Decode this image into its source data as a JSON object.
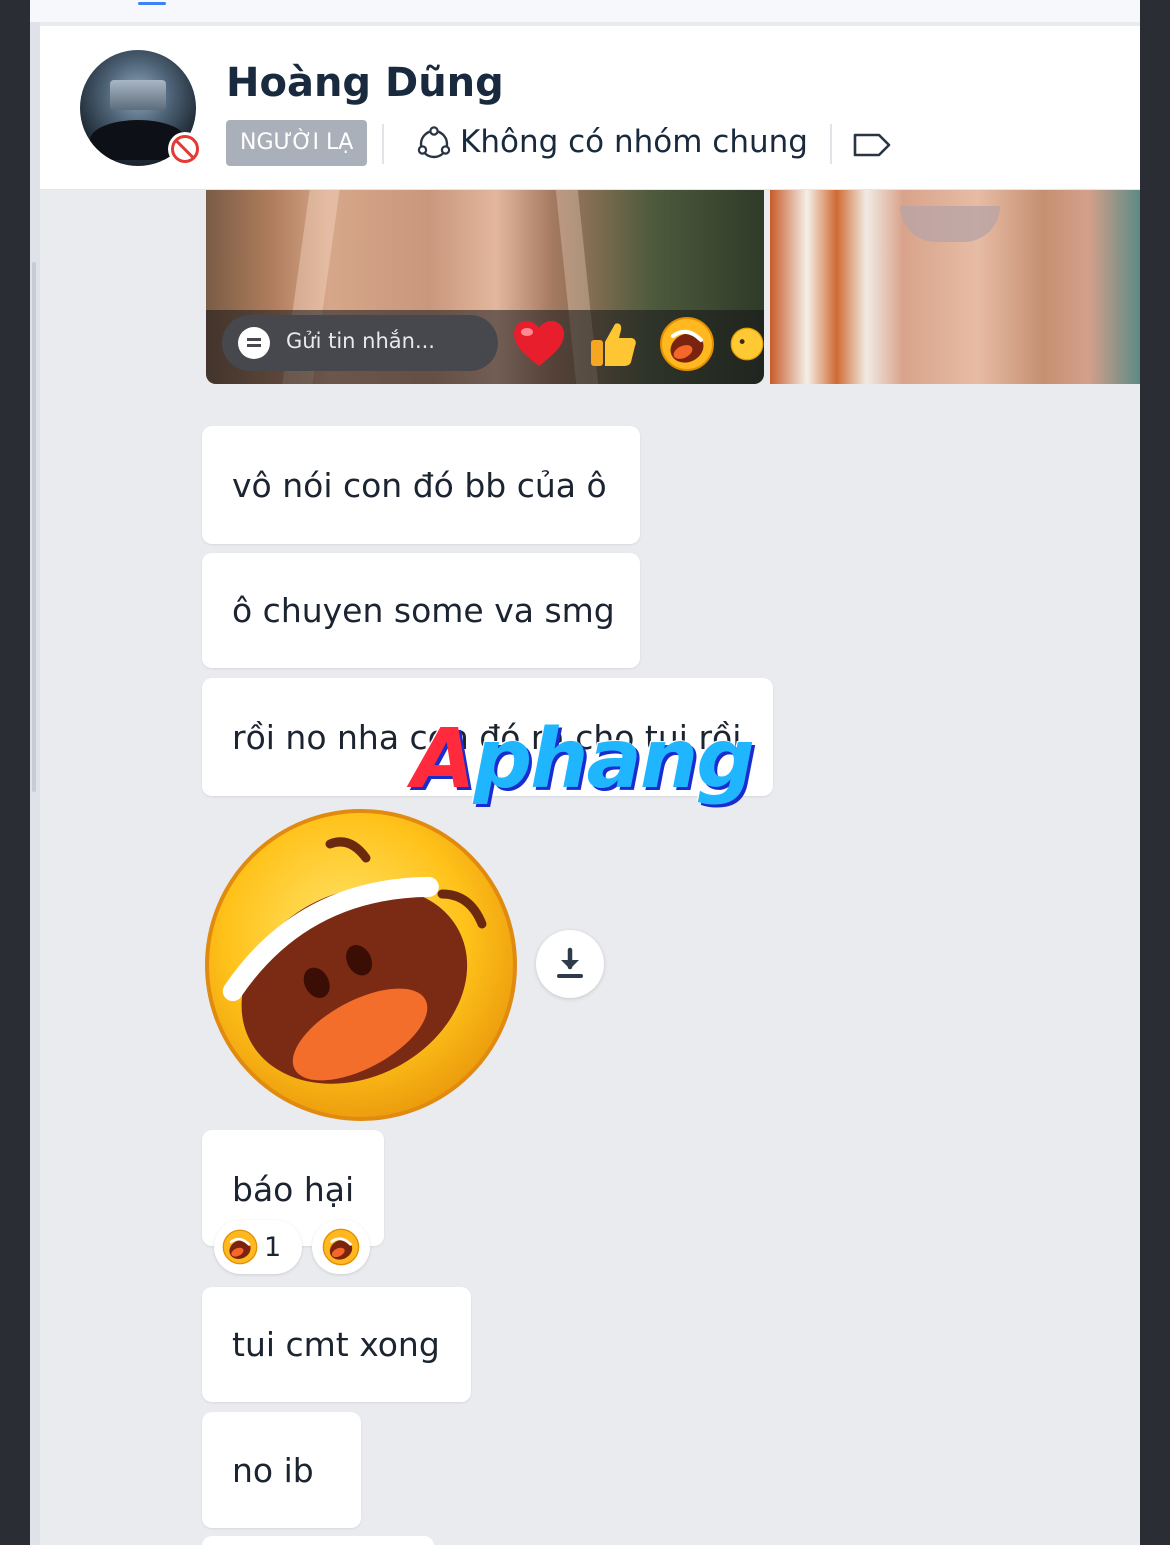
{
  "header": {
    "contact_name": "Hoàng Dũng",
    "stranger_tag": "NGƯỜI LẠ",
    "group_info": "Không có nhóm chung",
    "status": "blocked"
  },
  "quick_reply": {
    "placeholder": "Gửi tin nhắn...",
    "reactions": [
      "heart",
      "thumbs-up",
      "laughing",
      "smiling"
    ]
  },
  "messages": [
    "vô nói con đó bb của ô",
    "ô chuyen some va smg",
    "rồi no nha con đó ra cho tui rồi",
    "báo hại",
    "tui cmt xong",
    "no ib"
  ],
  "reaction_summary": {
    "emoji": "laughing",
    "count": "1"
  },
  "watermark": {
    "text_red": "A",
    "text_blue": "phang"
  },
  "icons": {
    "group": "group-circle-icon",
    "tag": "tag-icon",
    "download": "download-icon",
    "sticker": "laughing-face-sticker"
  },
  "colors": {
    "app_background": "#e9ebef",
    "bubble": "#ffffff",
    "text": "#1b2430",
    "stranger_tag": "#a9b0b9",
    "blocked_red": "#e53935"
  }
}
